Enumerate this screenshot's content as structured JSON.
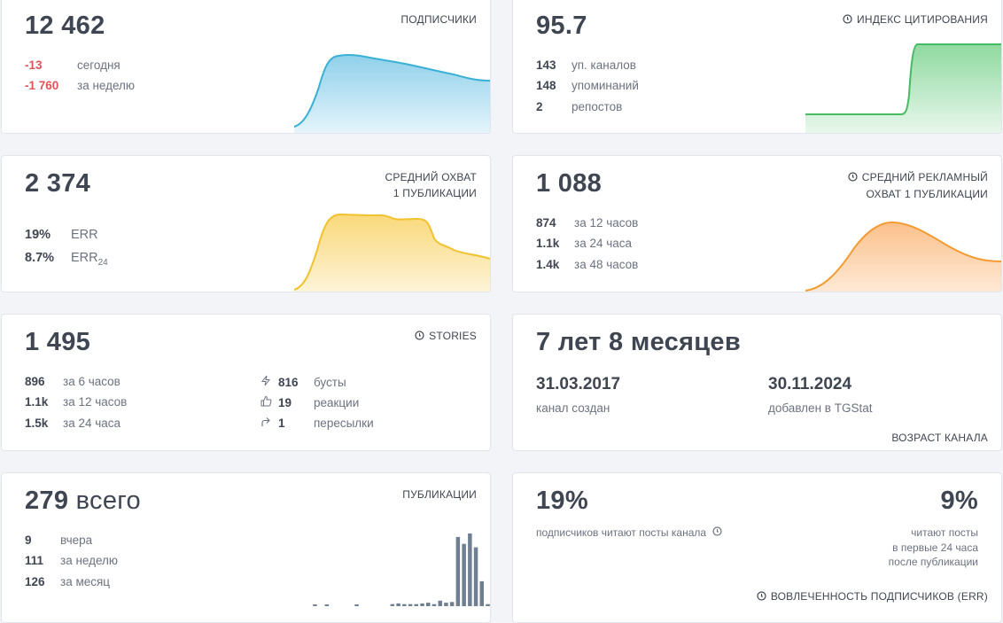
{
  "subscribers": {
    "value": "12 462",
    "label": "ПОДПИСЧИКИ",
    "today_value": "-13",
    "today_label": "сегодня",
    "week_value": "-1 760",
    "week_label": "за неделю",
    "accent": "#3ab0d6"
  },
  "citation": {
    "value": "95.7",
    "label": "ИНДЕКС ЦИТИРОВАНИЯ",
    "rows": [
      {
        "value": "143",
        "label": "уп. каналов"
      },
      {
        "value": "148",
        "label": "упоминаний"
      },
      {
        "value": "2",
        "label": "репостов"
      }
    ],
    "accent": "#47bb63"
  },
  "reach": {
    "value": "2 374",
    "label_line1": "СРЕДНИЙ ОХВАТ",
    "label_line2": "1 ПУБЛИКАЦИИ",
    "err_value": "19%",
    "err_label": "ERR",
    "err24_value": "8.7%",
    "err24_label": "ERR",
    "err24_sub": "24",
    "accent": "#f2c12e"
  },
  "ad_reach": {
    "value": "1 088",
    "label_line1": "СРЕДНИЙ РЕКЛАМНЫЙ",
    "label_line2": "ОХВАТ 1 ПУБЛИКАЦИИ",
    "rows": [
      {
        "value": "874",
        "label": "за 12 часов"
      },
      {
        "value": "1.1k",
        "label": "за 24 часа"
      },
      {
        "value": "1.4k",
        "label": "за 48 часов"
      }
    ],
    "accent": "#f39a32"
  },
  "stories": {
    "value": "1 495",
    "label": "STORIES",
    "left_rows": [
      {
        "value": "896",
        "label": "за 6 часов"
      },
      {
        "value": "1.1k",
        "label": "за 12 часов"
      },
      {
        "value": "1.5k",
        "label": "за 24 часа"
      }
    ],
    "right_rows": [
      {
        "icon": "lightning-icon",
        "value": "816",
        "label": "бусты"
      },
      {
        "icon": "thumbs-up-icon",
        "value": "19",
        "label": "реакции"
      },
      {
        "icon": "share-arrow-icon",
        "value": "1",
        "label": "пересылки"
      }
    ]
  },
  "age": {
    "value": "7 лет 8 месяцев",
    "created_date": "31.03.2017",
    "created_label": "канал создан",
    "added_date": "30.11.2024",
    "added_label": "добавлен в TGStat",
    "label": "ВОЗРАСТ КАНАЛА"
  },
  "publications": {
    "value": "279",
    "value_suffix": "всего",
    "label": "ПУБЛИКАЦИИ",
    "rows": [
      {
        "value": "9",
        "label": "вчера"
      },
      {
        "value": "111",
        "label": "за неделю"
      },
      {
        "value": "126",
        "label": "за месяц"
      }
    ],
    "bar_values": [
      0,
      0,
      0,
      0.2,
      0,
      0.2,
      0,
      0,
      0,
      0,
      0.2,
      0,
      0,
      0,
      0,
      0,
      0.3,
      0.4,
      0.3,
      0.3,
      0.3,
      0.4,
      0.5,
      0.3,
      0.8,
      0.5,
      0.6,
      10,
      9,
      10.5,
      8.5,
      3.6,
      0.3
    ],
    "accent": "#6f7f91"
  },
  "engagement": {
    "left_value": "19%",
    "left_label": "подписчиков читают посты канала",
    "right_value": "9%",
    "right_line1": "читают посты",
    "right_line2": "в первые 24 часа",
    "right_line3": "после публикации",
    "label": "ВОВЛЕЧЕННОСТЬ ПОДПИСЧИКОВ (ERR)"
  }
}
